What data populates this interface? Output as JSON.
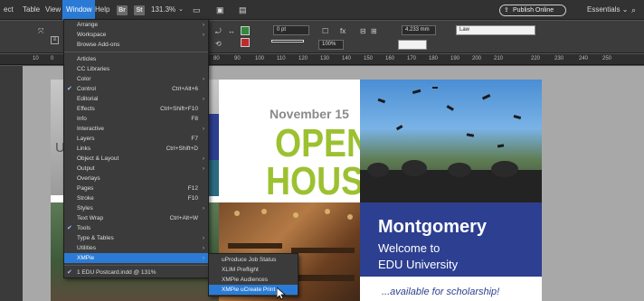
{
  "menubar": {
    "items": [
      "ect",
      "Table",
      "View",
      "Window",
      "Help"
    ],
    "active": "Window",
    "badges": [
      "Br",
      "St"
    ],
    "zoom": "131.3%",
    "publish_label": "Publish Online",
    "workspace_label": "Essentials",
    "search_glyph": "⌕"
  },
  "controlbar": {
    "stroke_weight": "0 pt",
    "opacity": "100%",
    "width_value": "4.233 mm",
    "style_name": "Law"
  },
  "ruler": {
    "ticks": [
      "10",
      "0",
      "80",
      "90",
      "100",
      "110",
      "120",
      "130",
      "140",
      "150",
      "160",
      "170",
      "180",
      "190",
      "200",
      "210",
      "220",
      "230",
      "240",
      "250"
    ]
  },
  "window_menu": {
    "items": [
      {
        "label": "Arrange",
        "submenu": true
      },
      {
        "label": "Workspace",
        "submenu": true
      },
      {
        "label": "Browse Add-ons"
      },
      {
        "sep": true
      },
      {
        "label": "Articles"
      },
      {
        "label": "CC Libraries"
      },
      {
        "label": "Color",
        "submenu": true
      },
      {
        "label": "Control",
        "checked": true,
        "shortcut": "Ctrl+Alt+6"
      },
      {
        "label": "Editorial",
        "submenu": true
      },
      {
        "label": "Effects",
        "shortcut": "Ctrl+Shift+F10"
      },
      {
        "label": "Info",
        "shortcut": "F8"
      },
      {
        "label": "Interactive",
        "submenu": true
      },
      {
        "label": "Layers",
        "shortcut": "F7"
      },
      {
        "label": "Links",
        "shortcut": "Ctrl+Shift+D"
      },
      {
        "label": "Object & Layout",
        "submenu": true
      },
      {
        "label": "Output",
        "submenu": true
      },
      {
        "label": "Overlays"
      },
      {
        "label": "Pages",
        "shortcut": "F12"
      },
      {
        "label": "Stroke",
        "shortcut": "F10"
      },
      {
        "label": "Styles",
        "submenu": true
      },
      {
        "label": "Text Wrap",
        "shortcut": "Ctrl+Alt+W"
      },
      {
        "label": "Tools",
        "checked": true
      },
      {
        "label": "Type & Tables",
        "submenu": true
      },
      {
        "label": "Utilities",
        "submenu": true
      },
      {
        "label": "XMPie",
        "submenu": true,
        "highlighted": true
      },
      {
        "sep": true
      },
      {
        "label": "1 EDU Postcard.indd @ 131%",
        "checked": true
      }
    ]
  },
  "xmpie_submenu": {
    "items": [
      {
        "label": "uProduce Job Status"
      },
      {
        "label": "XLIM Preflight"
      },
      {
        "label": "XMPie Audiences"
      },
      {
        "label": "XMPie uCreate Print",
        "highlighted": true
      }
    ]
  },
  "document": {
    "date_line": "November 15",
    "headline_1": "OPEN",
    "headline_2": "HOUSE",
    "letter_u": "U",
    "school_name": "Montgomery",
    "welcome_1": "Welcome to",
    "welcome_2": "EDU University",
    "bottom_text": "...available for scholarship!"
  },
  "colors": {
    "brand_blue": "#2d3f91",
    "headline_green": "#9cc130",
    "menu_highlight": "#2b7bd6"
  }
}
